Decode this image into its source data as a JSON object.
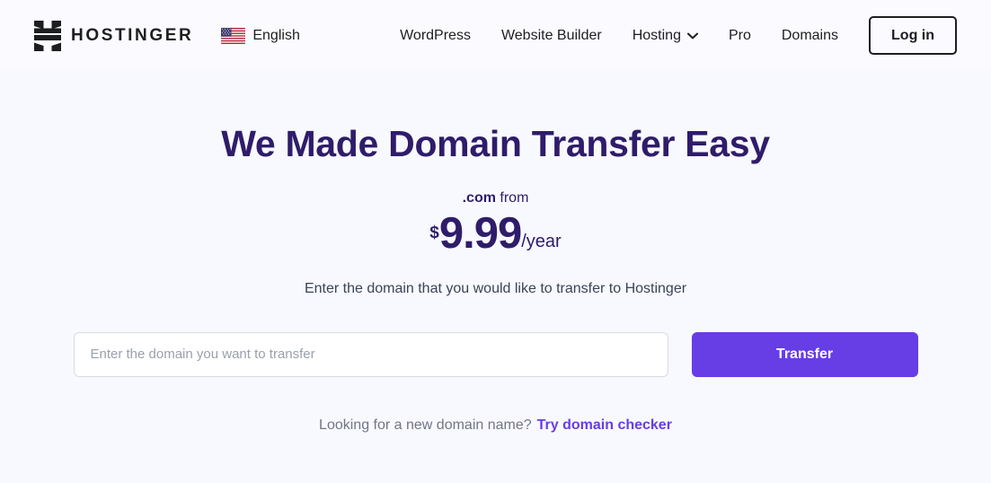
{
  "colors": {
    "page_background": "#f8f9fe",
    "header_background": "#fbfbff",
    "brand_purple": "#673de6",
    "heading_purple": "#2f1c6a",
    "text_dark": "#1d1e20",
    "muted_text": "#727586"
  },
  "header": {
    "brand_name": "HOSTINGER",
    "logo_icon": "hostinger-h-logo-icon",
    "language": {
      "flag_icon": "us-flag-icon",
      "label": "English"
    },
    "nav_items": [
      {
        "label": "WordPress",
        "has_dropdown": false
      },
      {
        "label": "Website Builder",
        "has_dropdown": false
      },
      {
        "label": "Hosting",
        "has_dropdown": true,
        "dropdown_icon": "chevron-down-icon"
      },
      {
        "label": "Pro",
        "has_dropdown": false
      },
      {
        "label": "Domains",
        "has_dropdown": false
      }
    ],
    "login_label": "Log in"
  },
  "hero": {
    "title": "We Made Domain Transfer Easy",
    "price_tld": ".com",
    "price_from_label": "from",
    "price_currency": "$",
    "price_amount": "9.99",
    "price_period": "/year",
    "subtitle": "Enter the domain that you would like to transfer to Hostinger"
  },
  "form": {
    "input_placeholder": "Enter the domain you want to transfer",
    "input_value": "",
    "submit_label": "Transfer"
  },
  "footer": {
    "prompt": "Looking for a new domain name?",
    "link_label": "Try domain checker"
  }
}
